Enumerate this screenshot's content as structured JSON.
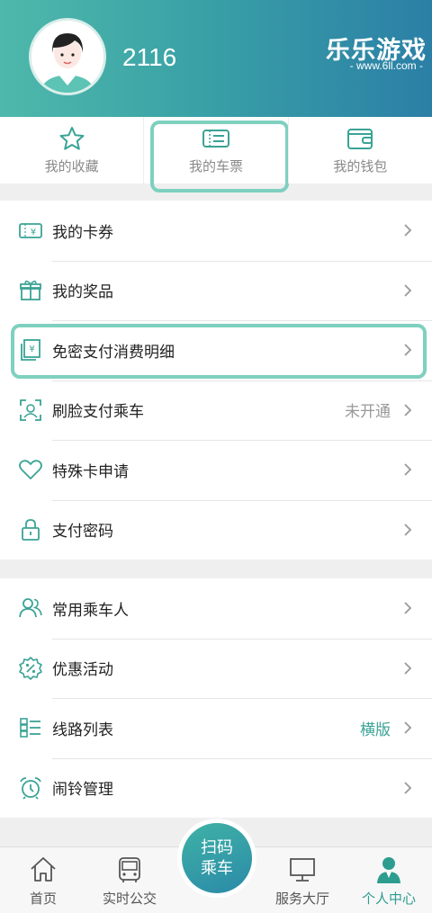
{
  "profile": {
    "username": "2116"
  },
  "watermark": {
    "title": "乐乐游戏",
    "subtitle": "- www.6ll.com -"
  },
  "quick_actions": [
    {
      "label": "我的收藏",
      "icon": "star-icon"
    },
    {
      "label": "我的车票",
      "icon": "ticket-icon",
      "highlighted": true
    },
    {
      "label": "我的钱包",
      "icon": "wallet-icon"
    }
  ],
  "menu_group_1": [
    {
      "label": "我的卡券",
      "icon": "coupon-icon"
    },
    {
      "label": "我的奖品",
      "icon": "gift-icon"
    },
    {
      "label": "免密支付消费明细",
      "icon": "receipt-icon",
      "highlighted": true
    },
    {
      "label": "刷脸支付乘车",
      "icon": "face-scan-icon",
      "status": "未开通"
    },
    {
      "label": "特殊卡申请",
      "icon": "heart-icon"
    },
    {
      "label": "支付密码",
      "icon": "lock-icon"
    }
  ],
  "menu_group_2": [
    {
      "label": "常用乘车人",
      "icon": "users-icon"
    },
    {
      "label": "优惠活动",
      "icon": "discount-icon"
    },
    {
      "label": "线路列表",
      "icon": "list-icon",
      "status": "横版"
    },
    {
      "label": "闹铃管理",
      "icon": "alarm-icon"
    }
  ],
  "tabbar": {
    "home": "首页",
    "realtime_bus": "实时公交",
    "scan": "扫码",
    "scan_line2": "乘车",
    "service_hall": "服务大厅",
    "profile": "个人中心",
    "active": "profile"
  },
  "colors": {
    "accent": "#3aa395",
    "header_start": "#4fb8ab",
    "header_end": "#2b7fa6",
    "highlight": "#7ed0bf"
  }
}
